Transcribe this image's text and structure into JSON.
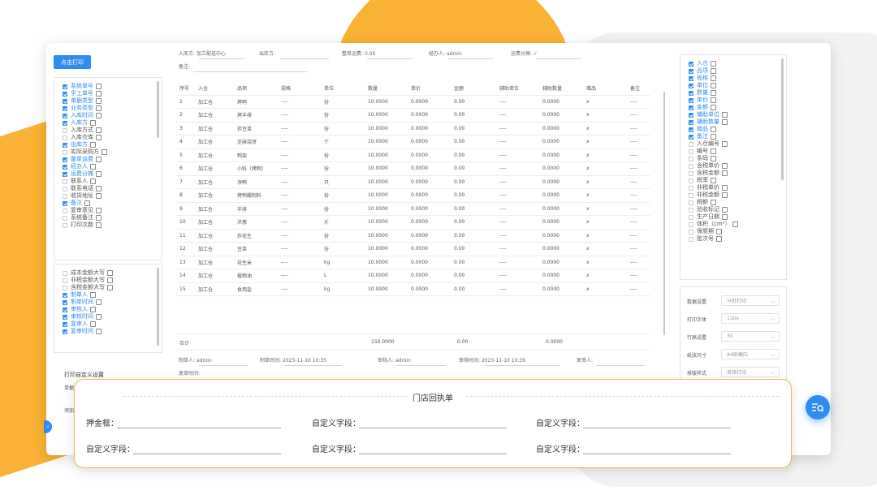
{
  "toolbar": {
    "print_label": "点击打印"
  },
  "header_fields": {
    "inbound": {
      "label": "入库方:",
      "value": "加工配送中心"
    },
    "outbound": {
      "label": "出库方:",
      "value": ""
    },
    "freight": {
      "label": "整单运费:",
      "value": "0.00"
    },
    "handler": {
      "label": "经办人:",
      "value": "admin"
    },
    "freight_split": {
      "label": "运费分摊:",
      "value": "√"
    },
    "remark": {
      "label": "备注:",
      "value": ""
    }
  },
  "left_fields_1": [
    {
      "label": "系统单号",
      "checked": true
    },
    {
      "label": "手工单号",
      "checked": true
    },
    {
      "label": "单据类型",
      "checked": true
    },
    {
      "label": "业务类型",
      "checked": true
    },
    {
      "label": "入库时间",
      "checked": true
    },
    {
      "label": "入库方",
      "checked": true
    },
    {
      "label": "入库方式",
      "checked": false
    },
    {
      "label": "入库仓库",
      "checked": false
    },
    {
      "label": "出库方",
      "checked": true
    },
    {
      "label": "实际采购方",
      "checked": false
    },
    {
      "label": "整单运费",
      "checked": true
    },
    {
      "label": "经办人",
      "checked": true
    },
    {
      "label": "运费分摊",
      "checked": true
    },
    {
      "label": "联系人",
      "checked": false
    },
    {
      "label": "联系电话",
      "checked": false
    },
    {
      "label": "收货地址",
      "checked": false
    },
    {
      "label": "备注",
      "checked": true
    },
    {
      "label": "复审意见",
      "checked": false
    },
    {
      "label": "系统备注",
      "checked": false
    },
    {
      "label": "打印次数",
      "checked": false
    }
  ],
  "left_fields_2": [
    {
      "label": "成本金额大写",
      "checked": false
    },
    {
      "label": "非税金额大写",
      "checked": false
    },
    {
      "label": "含税金额大写",
      "checked": false
    },
    {
      "label": "制单人",
      "checked": true
    },
    {
      "label": "制单时间",
      "checked": true
    },
    {
      "label": "审核人",
      "checked": true
    },
    {
      "label": "审核时间",
      "checked": true
    },
    {
      "label": "复审人",
      "checked": true
    },
    {
      "label": "复审时间",
      "checked": true
    }
  ],
  "left_bottom": {
    "custom_settings": "打印自定义设置",
    "single_row": "单据",
    "add_row": "添加"
  },
  "table": {
    "headers": [
      "序号",
      "入仓",
      "品项",
      "规格",
      "单位",
      "数量",
      "单价",
      "金额",
      "辅助单位",
      "辅助数量",
      "赠品",
      "备注"
    ],
    "rows": [
      [
        "1",
        "加工仓",
        "烤鸭",
        "----",
        "份",
        "10.0000",
        "0.0000",
        "0.00",
        "----",
        "0.0000",
        "x",
        "----"
      ],
      [
        "2",
        "加工仓",
        "烤羊排",
        "----",
        "份",
        "10.0000",
        "0.0000",
        "0.00",
        "----",
        "0.0000",
        "x",
        "----"
      ],
      [
        "3",
        "加工仓",
        "拌豆苗",
        "----",
        "份",
        "10.0000",
        "0.0000",
        "0.00",
        "----",
        "0.0000",
        "x",
        "----"
      ],
      [
        "4",
        "加工仓",
        "芝麻烧饼",
        "----",
        "个",
        "10.0000",
        "0.0000",
        "0.00",
        "----",
        "0.0000",
        "x",
        "----"
      ],
      [
        "5",
        "加工仓",
        "鸭架",
        "----",
        "份",
        "10.0000",
        "0.0000",
        "0.00",
        "----",
        "0.0000",
        "x",
        "----"
      ],
      [
        "6",
        "加工仓",
        "小料（烤鸭）",
        "----",
        "份",
        "10.0000",
        "0.0000",
        "0.00",
        "----",
        "0.0000",
        "x",
        "----"
      ],
      [
        "7",
        "加工仓",
        "净鸭",
        "----",
        "只",
        "10.0000",
        "0.0000",
        "0.00",
        "----",
        "0.0000",
        "x",
        "----"
      ],
      [
        "8",
        "加工仓",
        "烤鸭酸制料",
        "----",
        "份",
        "10.0000",
        "0.0000",
        "0.00",
        "----",
        "0.0000",
        "x",
        "----"
      ],
      [
        "9",
        "加工仓",
        "羊排",
        "----",
        "份",
        "10.0000",
        "0.0000",
        "0.00",
        "----",
        "0.0000",
        "x",
        "----"
      ],
      [
        "10",
        "加工仓",
        "洋葱",
        "----",
        "斤",
        "10.0000",
        "0.0000",
        "0.00",
        "----",
        "0.0000",
        "x",
        "----"
      ],
      [
        "11",
        "加工仓",
        "炸花生",
        "----",
        "份",
        "10.0000",
        "0.0000",
        "0.00",
        "----",
        "0.0000",
        "x",
        "----"
      ],
      [
        "12",
        "加工仓",
        "豆苗",
        "----",
        "份",
        "10.0000",
        "0.0000",
        "0.00",
        "----",
        "0.0000",
        "x",
        "----"
      ],
      [
        "13",
        "加工仓",
        "花生米",
        "----",
        "kg",
        "10.0000",
        "0.0000",
        "0.00",
        "----",
        "0.0000",
        "x",
        "----"
      ],
      [
        "14",
        "加工仓",
        "植物油",
        "----",
        "L",
        "10.0000",
        "0.0000",
        "0.00",
        "----",
        "0.0000",
        "x",
        "----"
      ],
      [
        "15",
        "加工仓",
        "食用盐",
        "----",
        "kg",
        "10.0000",
        "0.0000",
        "0.00",
        "----",
        "0.0000",
        "x",
        "----"
      ]
    ],
    "total_label": "合计",
    "total_qty": "150.0000",
    "total_amount": "0.00",
    "total_aux_qty": "0.0000"
  },
  "footer_fields": {
    "creator": {
      "label": "制单人:",
      "value": "admin"
    },
    "create_time": {
      "label": "制单时间:",
      "value": "2023-11-10 10:35"
    },
    "auditor": {
      "label": "审核人:",
      "value": "admin"
    },
    "audit_time": {
      "label": "审核时间:",
      "value": "2023-11-10 10:39"
    },
    "reviewer": {
      "label": "复审人:",
      "value": ""
    },
    "review_time": {
      "label": "复审时间:",
      "value": ""
    }
  },
  "right_fields": [
    {
      "label": "入仓",
      "checked": true
    },
    {
      "label": "品项",
      "checked": true
    },
    {
      "label": "规格",
      "checked": true
    },
    {
      "label": "单位",
      "checked": true
    },
    {
      "label": "数量",
      "checked": true
    },
    {
      "label": "单价",
      "checked": true
    },
    {
      "label": "金额",
      "checked": true
    },
    {
      "label": "辅助单位",
      "checked": true
    },
    {
      "label": "辅助数量",
      "checked": true
    },
    {
      "label": "赠品",
      "checked": true
    },
    {
      "label": "备注",
      "checked": true
    },
    {
      "label": "入仓编号",
      "checked": false
    },
    {
      "label": "编号",
      "checked": false
    },
    {
      "label": "条码",
      "checked": false
    },
    {
      "label": "含税单价",
      "checked": false
    },
    {
      "label": "含税金额",
      "checked": false
    },
    {
      "label": "税率",
      "checked": false
    },
    {
      "label": "非税单价",
      "checked": false
    },
    {
      "label": "非税金额",
      "checked": false
    },
    {
      "label": "税额",
      "checked": false
    },
    {
      "label": "验收标记",
      "checked": false
    },
    {
      "label": "生产日期",
      "checked": false
    },
    {
      "label": "体积（cm³）",
      "checked": false
    },
    {
      "label": "保质期",
      "checked": false
    },
    {
      "label": "批次号",
      "checked": false
    }
  ],
  "settings": [
    {
      "label": "数据设置",
      "value": "分批打印"
    },
    {
      "label": "打印字体",
      "value": "12px"
    },
    {
      "label": "行高设置",
      "value": "30"
    },
    {
      "label": "纸张尺寸",
      "value": "A4纸横向"
    },
    {
      "label": "排版样式",
      "value": "单排打印"
    }
  ],
  "receipt": {
    "title": "门店回执单",
    "fields": [
      [
        "押金框：",
        "自定义字段：",
        "自定义字段："
      ],
      [
        "自定义字段：",
        "自定义字段：",
        "自定义字段："
      ]
    ]
  },
  "colors": {
    "accent": "#2f8cf0",
    "brand_yellow": "#f9b233"
  },
  "icons": {
    "fab": "list-search-icon",
    "edit": "edit-icon",
    "collapse": "chevron-left-icon"
  }
}
